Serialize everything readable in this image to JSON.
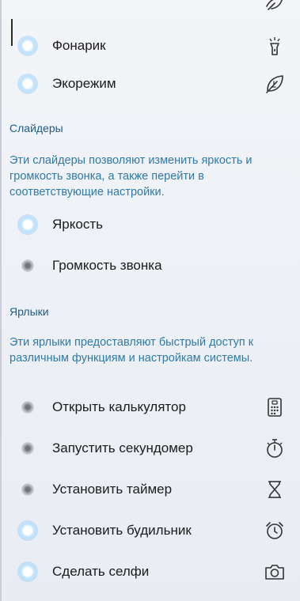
{
  "toggles": [
    {
      "label": "Фонарик",
      "state": "on",
      "icon": "flashlight-icon"
    },
    {
      "label": "Экорежим",
      "state": "on",
      "icon": "leaf-icon"
    }
  ],
  "sliders_section": {
    "title": "Слайдеры",
    "description": "Эти слайдеры позволяют изменить яркость и громкость звонка, а также перейти в соответствующие настройки.",
    "items": [
      {
        "label": "Яркость",
        "state": "on"
      },
      {
        "label": "Громкость звонка",
        "state": "off"
      }
    ]
  },
  "shortcuts_section": {
    "title": "Ярлыки",
    "description": "Эти ярлыки предоставляют быстрый доступ к различным функциям и настройкам системы.",
    "items": [
      {
        "label": "Открыть калькулятор",
        "state": "off",
        "icon": "calculator-icon"
      },
      {
        "label": "Запустить секундомер",
        "state": "off",
        "icon": "stopwatch-icon"
      },
      {
        "label": "Установить таймер",
        "state": "off",
        "icon": "hourglass-icon"
      },
      {
        "label": "Установить будильник",
        "state": "on",
        "icon": "alarm-clock-icon"
      },
      {
        "label": "Сделать селфи",
        "state": "on",
        "icon": "camera-icon"
      }
    ]
  },
  "colors": {
    "accent": "#2f7aa8",
    "section_title": "#1f5c8a",
    "text": "#1b1b1b"
  }
}
